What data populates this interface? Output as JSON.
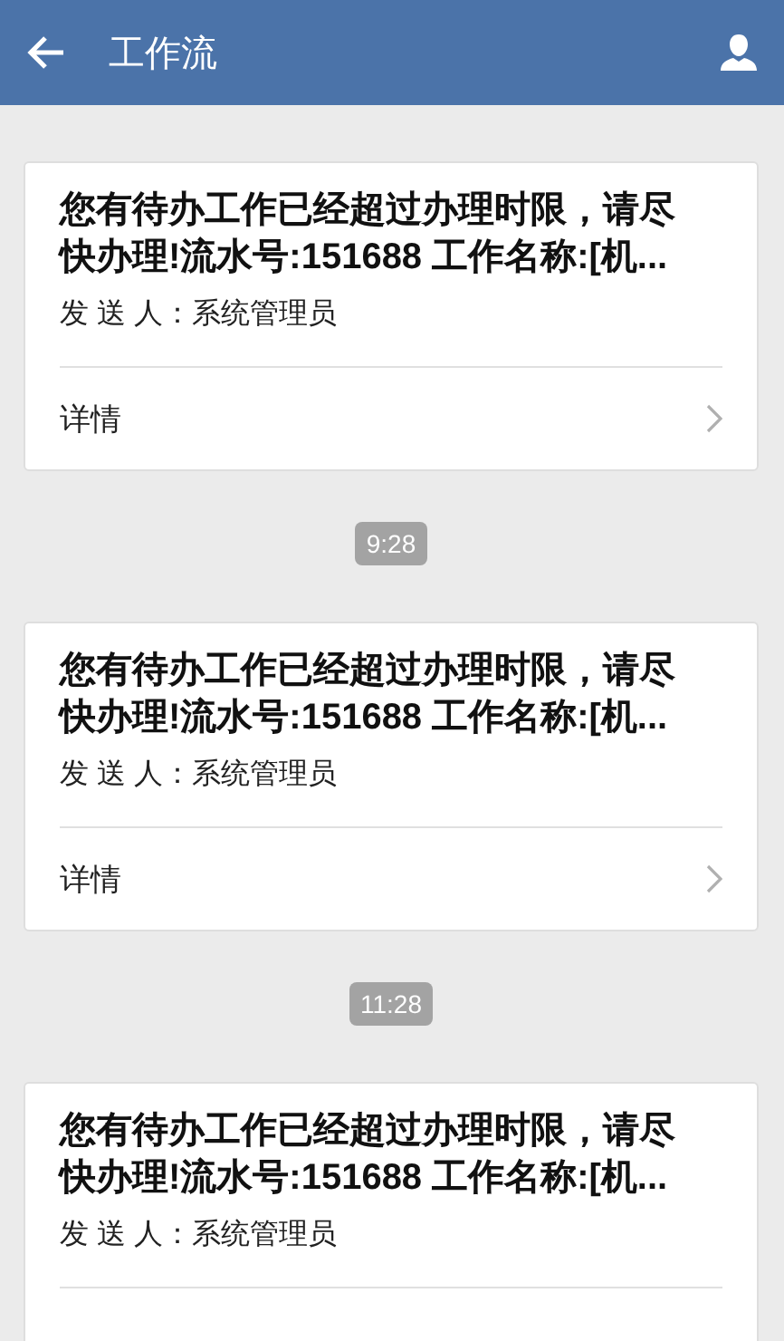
{
  "header": {
    "title": "工作流"
  },
  "messages": [
    {
      "title": "您有待办工作已经超过办理时限，请尽快办理!流水号:151688 工作名称:[机...",
      "sender": "发 送 人：系统管理员",
      "detail": "详情"
    },
    {
      "time": "9:28",
      "title": "您有待办工作已经超过办理时限，请尽快办理!流水号:151688 工作名称:[机...",
      "sender": "发 送 人：系统管理员",
      "detail": "详情"
    },
    {
      "time": "11:28",
      "title": "您有待办工作已经超过办理时限，请尽快办理!流水号:151688 工作名称:[机...",
      "sender": "发 送 人：系统管理员"
    }
  ]
}
